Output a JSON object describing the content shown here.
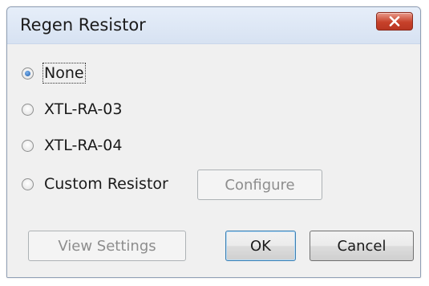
{
  "window": {
    "title": "Regen Resistor"
  },
  "options": [
    {
      "label": "None",
      "checked": true
    },
    {
      "label": "XTL-RA-03",
      "checked": false
    },
    {
      "label": "XTL-RA-04",
      "checked": false
    },
    {
      "label": "Custom Resistor",
      "checked": false
    }
  ],
  "buttons": {
    "configure": "Configure",
    "view_settings": "View Settings",
    "ok": "OK",
    "cancel": "Cancel"
  },
  "icons": {
    "close": "close-icon"
  },
  "colors": {
    "close_button": "#c7412a",
    "radio_selected": "#1d5aa8"
  }
}
